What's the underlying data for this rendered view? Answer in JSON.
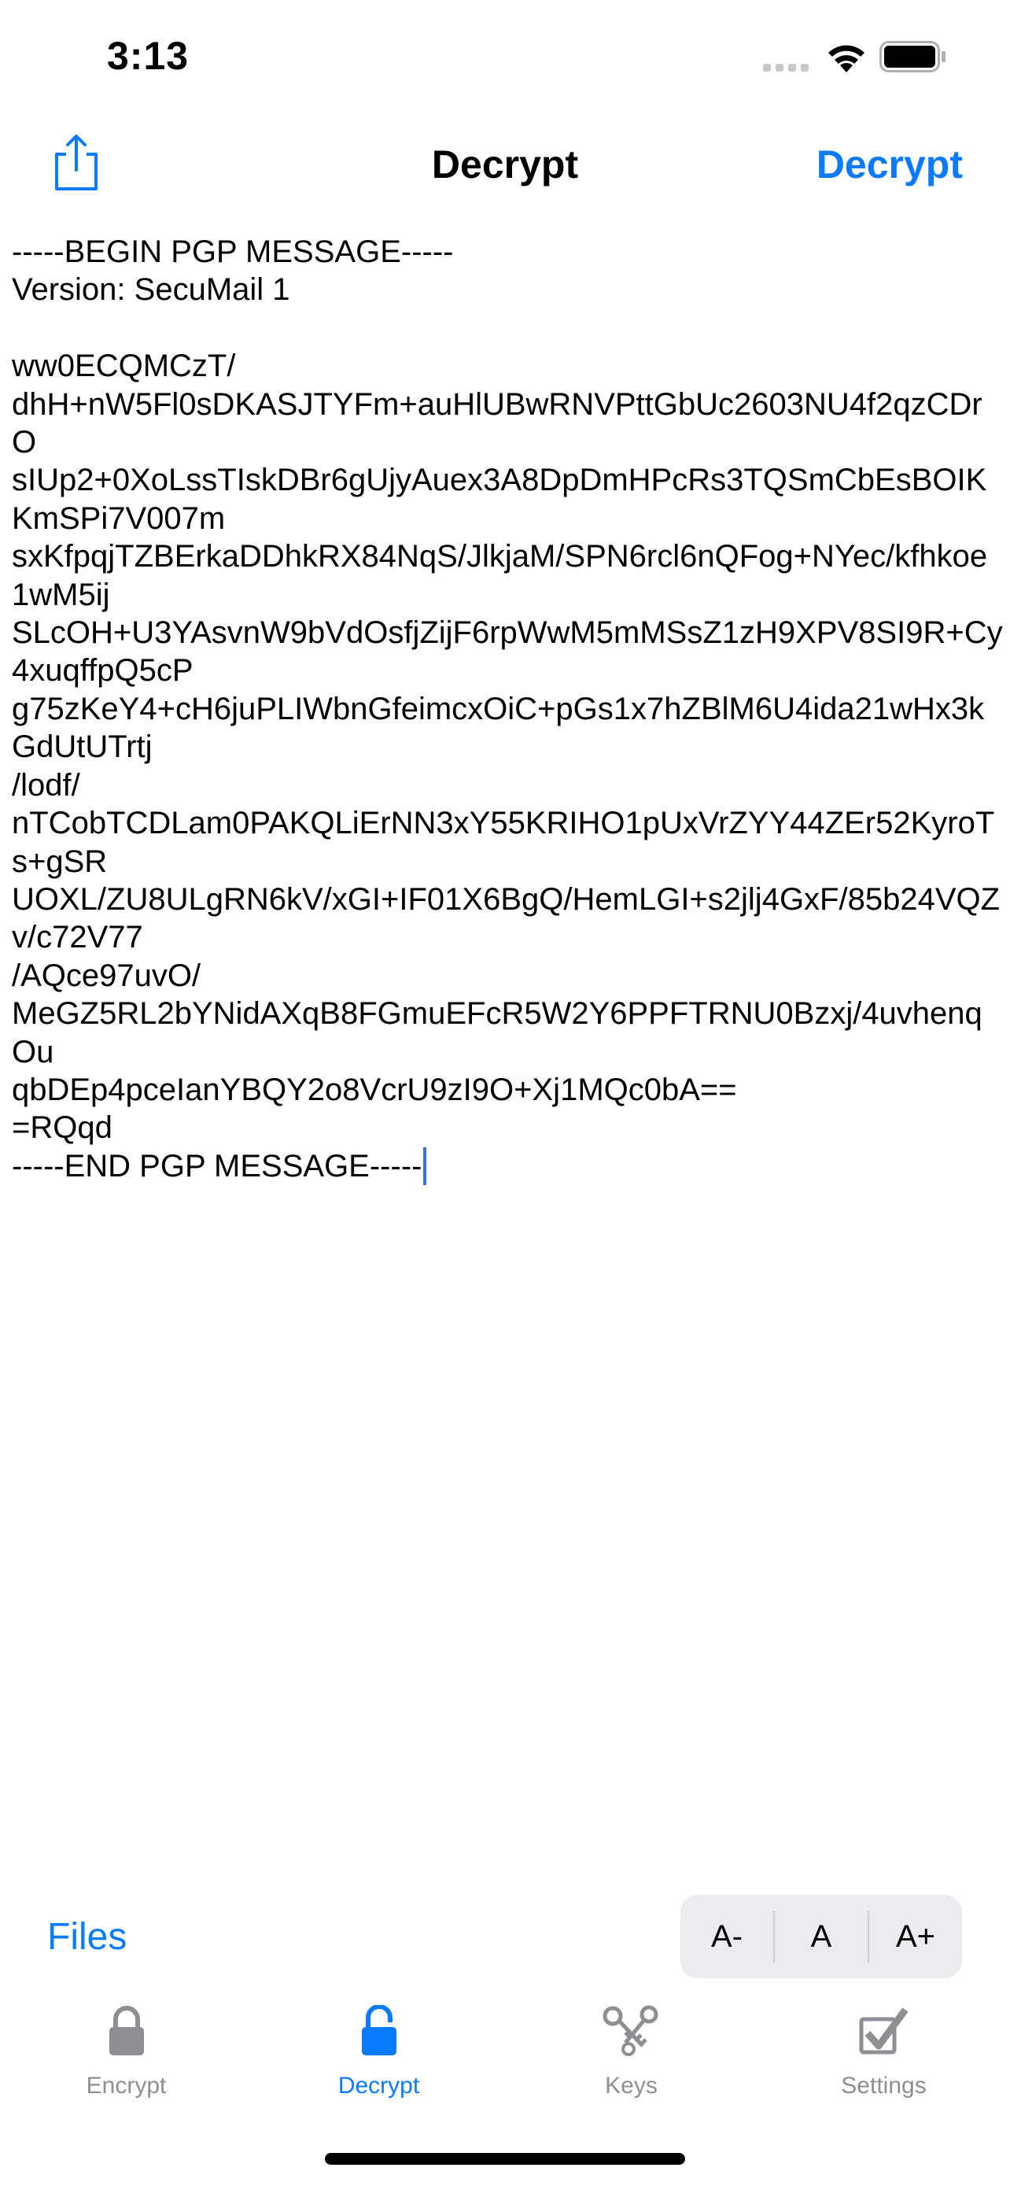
{
  "status": {
    "time": "3:13"
  },
  "nav": {
    "title": "Decrypt",
    "action": "Decrypt"
  },
  "editor": {
    "text": "-----BEGIN PGP MESSAGE-----\nVersion: SecuMail 1\n\nww0ECQMCzT/\ndhH+nW5Fl0sDKASJTYFm+auHlUBwRNVPttGbUc2603NU4f2qzCDrO\nsIUp2+0XoLssTIskDBr6gUjyAuex3A8DpDmHPcRs3TQSmCbEsBOIKKmSPi7V007m\nsxKfpqjTZBErkaDDhkRX84NqS/JlkjaM/SPN6rcl6nQFog+NYec/kfhkoe1wM5ij\nSLcOH+U3YAsvnW9bVdOsfjZijF6rpWwM5mMSsZ1zH9XPV8SI9R+Cy4xuqffpQ5cP\ng75zKeY4+cH6juPLIWbnGfeimcxOiC+pGs1x7hZBlM6U4ida21wHx3kGdUtUTrtj\n/lodf/\nnTCobTCDLam0PAKQLiErNN3xY55KRIHO1pUxVrZYY44ZEr52KyroTs+gSR\nUOXL/ZU8ULgRN6kV/xGI+IF01X6BgQ/HemLGI+s2jlj4GxF/85b24VQZv/c72V77\n/AQce97uvO/\nMeGZ5RL2bYNidAXqB8FGmuEFcR5W2Y6PPFTRNU0Bzxj/4uvhenqOu\nqbDEp4pceIanYBQY2o8VcrU9zI9O+Xj1MQc0bA==\n=RQqd\n-----END PGP MESSAGE-----"
  },
  "toolbar": {
    "files": "Files",
    "font_smaller": "A-",
    "font_default": "A",
    "font_larger": "A+"
  },
  "tabs": [
    {
      "label": "Encrypt",
      "icon": "lock-icon",
      "active": false
    },
    {
      "label": "Decrypt",
      "icon": "unlock-icon",
      "active": true
    },
    {
      "label": "Keys",
      "icon": "keys-icon",
      "active": false
    },
    {
      "label": "Settings",
      "icon": "checkmark-box-icon",
      "active": false
    }
  ],
  "colors": {
    "accent": "#0a7aff",
    "inactive": "#8e8e93",
    "segment_bg": "#ececee"
  }
}
